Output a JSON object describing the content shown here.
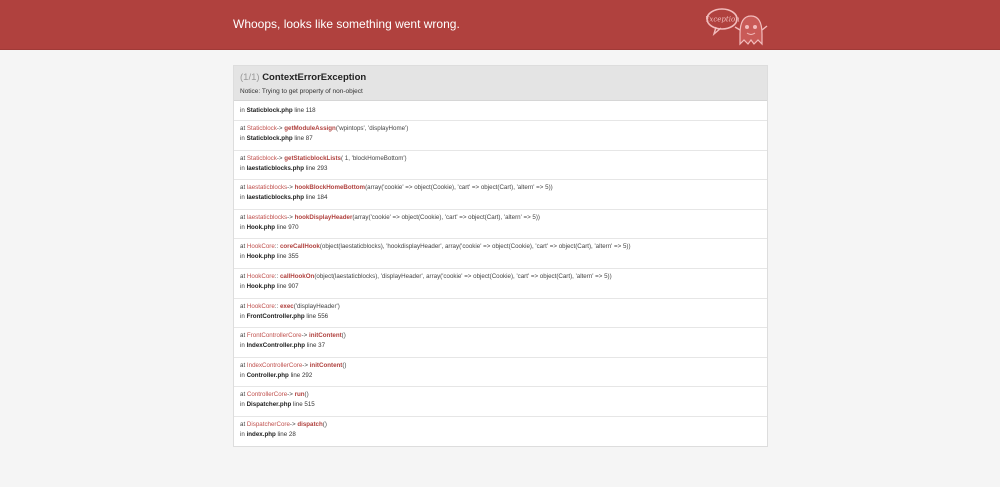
{
  "header": {
    "title": "Whoops, looks like something went wrong.",
    "logo_text": "Exception"
  },
  "exception": {
    "count": "(1/1)",
    "class": "ContextErrorException",
    "message": "Notice: Trying to get property of non-object"
  },
  "trace": [
    {
      "file": "Staticblock.php",
      "line": "118"
    },
    {
      "class": "Staticblock",
      "sep": "->",
      "method": "getModuleAssign",
      "args": "('wpintops', 'displayHome')",
      "file": "Staticblock.php",
      "line": "87"
    },
    {
      "class": "Staticblock",
      "sep": "->",
      "method": "getStaticblockLists",
      "args": "( 1, 'blockHomeBottom')",
      "file": "laestaticblocks.php",
      "line": "293"
    },
    {
      "class": "laestaticblocks",
      "sep": "->",
      "method": "hookBlockHomeBottom",
      "args": "(array('cookie' => object(Cookie), 'cart' => object(Cart), 'altern' => 5))",
      "file": "laestaticblocks.php",
      "line": "184"
    },
    {
      "class": "laestaticblocks",
      "sep": "->",
      "method": "hookDisplayHeader",
      "args": "(array('cookie' => object(Cookie), 'cart' => object(Cart), 'altern' => 5))",
      "file": "Hook.php",
      "line": "970"
    },
    {
      "class": "HookCore",
      "sep": "::",
      "method": "coreCallHook",
      "args": "(object(laestaticblocks), 'hookdisplayHeader', array('cookie' => object(Cookie), 'cart' => object(Cart), 'altern' => 5))",
      "file": "Hook.php",
      "line": "355"
    },
    {
      "class": "HookCore",
      "sep": "::",
      "method": "callHookOn",
      "args": "(object(laestaticblocks), 'displayHeader', array('cookie' => object(Cookie), 'cart' => object(Cart), 'altern' => 5))",
      "file": "Hook.php",
      "line": "907"
    },
    {
      "class": "HookCore",
      "sep": "::",
      "method": "exec",
      "args": "('displayHeader')",
      "file": "FrontController.php",
      "line": "556"
    },
    {
      "class": "FrontControllerCore",
      "sep": "->",
      "method": "initContent",
      "args": "()",
      "file": "IndexController.php",
      "line": "37"
    },
    {
      "class": "IndexControllerCore",
      "sep": "->",
      "method": "initContent",
      "args": "()",
      "file": "Controller.php",
      "line": "292"
    },
    {
      "class": "ControllerCore",
      "sep": "->",
      "method": "run",
      "args": "()",
      "file": "Dispatcher.php",
      "line": "515"
    },
    {
      "class": "DispatcherCore",
      "sep": "->",
      "method": "dispatch",
      "args": "()",
      "file": "index.php",
      "line": "28"
    }
  ],
  "labels": {
    "at": "at",
    "in": "in",
    "line": "line"
  }
}
